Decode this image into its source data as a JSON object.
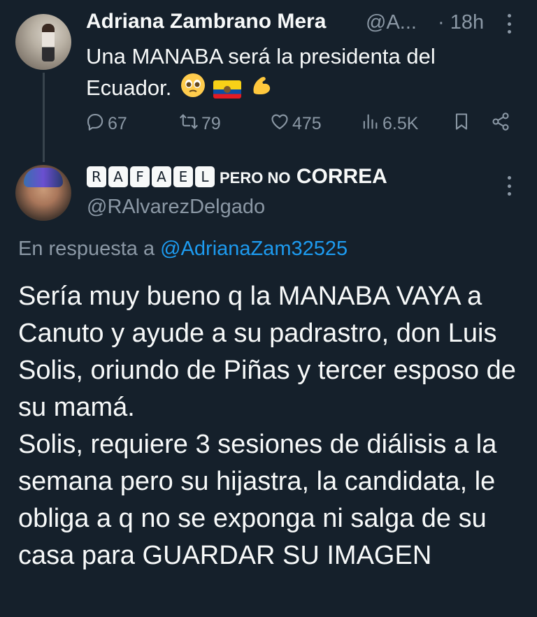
{
  "parent_tweet": {
    "display_name": "Adriana Zambrano Mera",
    "handle": "@A...",
    "time": "· 18h",
    "text": "Una MANABA será la presidenta del Ecuador.",
    "emojis": [
      "pleading-face",
      "ecuador-flag",
      "flexed-biceps"
    ],
    "actions": {
      "replies": "67",
      "retweets": "79",
      "likes": "475",
      "views": "6.5K"
    },
    "icons": {
      "reply": "reply-icon",
      "retweet": "retweet-icon",
      "like": "heart-icon",
      "views": "views-icon",
      "bookmark": "bookmark-icon",
      "share": "share-icon",
      "more": "more-icon"
    }
  },
  "reply_tweet": {
    "name_boxed_letters": [
      "R",
      "A",
      "F",
      "A",
      "E",
      "L"
    ],
    "name_rest_small": "PERO NO",
    "name_rest": "CORREA",
    "handle": "@RAlvarezDelgado",
    "replying_to_label": "En respuesta a",
    "replying_to_handle": "@AdrianaZam32525",
    "text": "Sería muy bueno q la MANABA VAYA a Canuto y ayude a su padrastro, don Luis Solis, oriundo de Piñas y tercer esposo de su mamá.\nSolis, requiere 3 sesiones de diálisis a la semana pero su hijastra, la candidata, le obliga a q no se exponga ni salga de su casa para GUARDAR SU IMAGEN"
  },
  "colors": {
    "background": "#15202b",
    "primary_text": "#f7f9f9",
    "secondary_text": "#8b98a5",
    "link": "#1d9bf0",
    "thread_line": "#38444d"
  }
}
